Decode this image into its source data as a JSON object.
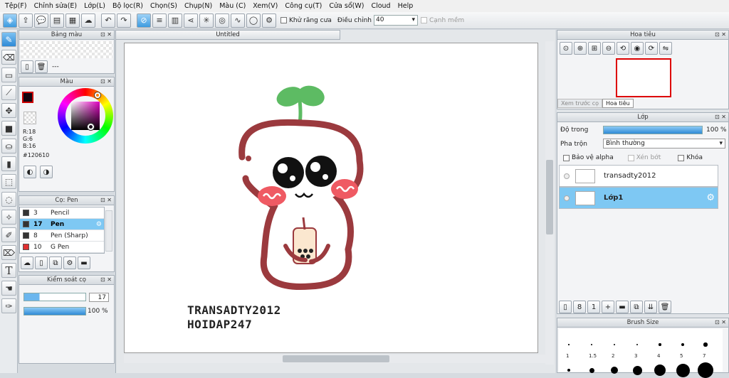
{
  "menu": [
    "Tệp(F)",
    "Chỉnh sửa(E)",
    "Lớp(L)",
    "Bộ lọc(R)",
    "Chọn(S)",
    "Chụp(N)",
    "Màu (C)",
    "Xem(V)",
    "Công cụ(T)",
    "Cửa sổ(W)",
    "Cloud",
    "Help"
  ],
  "toolbar": {
    "antialias_label": "Khử răng cưa",
    "adjust_label": "Điều chỉnh",
    "adjust_value": "40",
    "smooth_label": "Cạnh mềm"
  },
  "panels": {
    "palette_title": "Bảng màu",
    "palette_none": "---",
    "color_title": "Màu",
    "color_r": "R:18",
    "color_g": "G:6",
    "color_b": "B:16",
    "color_hex": "#120610",
    "brush_title": "Cọ: Pen",
    "brushes": [
      {
        "size": "3",
        "name": "Pencil",
        "color": "#333333"
      },
      {
        "size": "17",
        "name": "Pen",
        "color": "#333333"
      },
      {
        "size": "8",
        "name": "Pen (Sharp)",
        "color": "#333333"
      },
      {
        "size": "10",
        "name": "G Pen",
        "color": "#e03030"
      }
    ],
    "control_title": "Kiểm soát cọ",
    "control_size": "17",
    "control_opacity": "100 %",
    "nav_title": "Hoa tiêu",
    "nav_tab_preview": "Xem trước cọ",
    "nav_tab_nav": "Hoa tiêu",
    "layer_title": "Lớp",
    "opacity_label": "Độ trong",
    "opacity_value": "100 %",
    "blend_label": "Pha trộn",
    "blend_value": "Bình thường",
    "protect_alpha": "Bảo vệ alpha",
    "clip_label": "Xén bớt",
    "lock_label": "Khóa",
    "layers": [
      {
        "name": "transadty2012"
      },
      {
        "name": "Lớp1"
      }
    ],
    "brushsize_title": "Brush Size",
    "brush_sizes": [
      "1",
      "1.5",
      "2",
      "3",
      "4",
      "5",
      "7"
    ]
  },
  "canvas": {
    "tab": "Untitled",
    "text_line1": "TRANSADTY2012",
    "text_line2": "HOIDAP247"
  },
  "colors": {
    "fg": "#120610",
    "accent": "#3e9be0",
    "outline": "#9b3a3e"
  }
}
